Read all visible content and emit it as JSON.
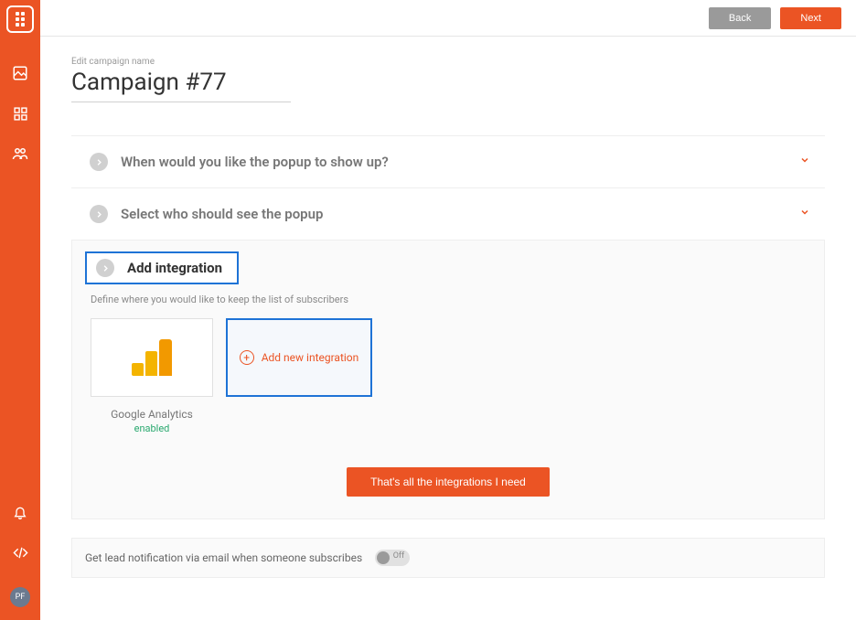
{
  "colors": {
    "accent": "#eb5424",
    "highlight": "#1e73d6"
  },
  "topbar": {
    "back_label": "Back",
    "next_label": "Next"
  },
  "sidebar": {
    "avatar_initials": "PF"
  },
  "campaign": {
    "edit_label": "Edit campaign name",
    "title": "Campaign #77"
  },
  "sections": [
    {
      "title": "When would you like the popup to show up?"
    },
    {
      "title": "Select who should see the popup"
    }
  ],
  "integration": {
    "heading": "Add integration",
    "subtitle": "Define where you would like to keep the list of subscribers",
    "cards": [
      {
        "name": "Google Analytics",
        "status": "enabled"
      }
    ],
    "add_label": "Add new integration",
    "done_label": "That's all the integrations I need"
  },
  "notification": {
    "text": "Get lead notification via email when someone subscribes",
    "toggle_state": "Off"
  }
}
